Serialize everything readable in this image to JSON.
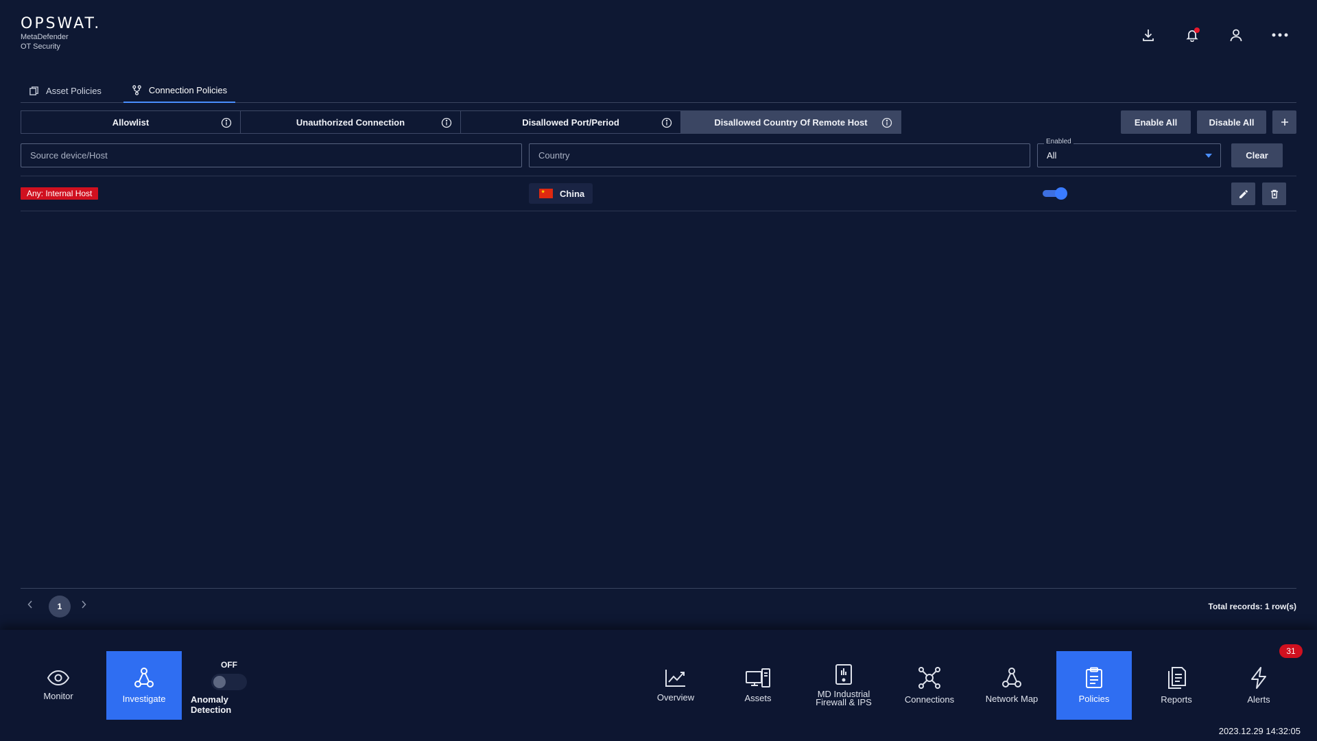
{
  "header": {
    "brand": "OPSWAT.",
    "product_line1": "MetaDefender",
    "product_line2": "OT Security",
    "icons": [
      "download-icon",
      "bell-icon",
      "user-icon",
      "more-icon"
    ]
  },
  "tabs": [
    {
      "label": "Asset Policies",
      "icon": "asset-policies-icon",
      "active": false
    },
    {
      "label": "Connection Policies",
      "icon": "connection-policies-icon",
      "active": true
    }
  ],
  "policy_tabs": [
    {
      "label": "Allowlist",
      "active": false
    },
    {
      "label": "Unauthorized Connection",
      "active": false
    },
    {
      "label": "Disallowed Port/Period",
      "active": false
    },
    {
      "label": "Disallowed Country Of Remote Host",
      "active": true
    }
  ],
  "actions": {
    "enable_all": "Enable All",
    "disable_all": "Disable All",
    "add": "+"
  },
  "filters": {
    "source_placeholder": "Source device/Host",
    "country_placeholder": "Country",
    "enabled_label": "Enabled",
    "enabled_value": "All",
    "clear": "Clear"
  },
  "rows": [
    {
      "source": "Any: Internal Host",
      "country": "China",
      "enabled": true
    }
  ],
  "pagination": {
    "current_page": "1",
    "total": "Total records: 1 row(s)"
  },
  "bottom_nav": {
    "monitor": "Monitor",
    "investigate": "Investigate",
    "anomaly_state": "OFF",
    "anomaly_label": "Anomaly Detection",
    "overview": "Overview",
    "assets": "Assets",
    "firewall_line1": "MD Industrial",
    "firewall_line2": "Firewall & IPS",
    "connections": "Connections",
    "network_map": "Network Map",
    "policies": "Policies",
    "reports": "Reports",
    "alerts": "Alerts",
    "alerts_count": "31"
  },
  "timestamp": "2023.12.29 14:32:05",
  "colors": {
    "background": "#0e1833",
    "accent": "#2f6ef2",
    "danger": "#d0101f",
    "panel": "#3b4663"
  }
}
